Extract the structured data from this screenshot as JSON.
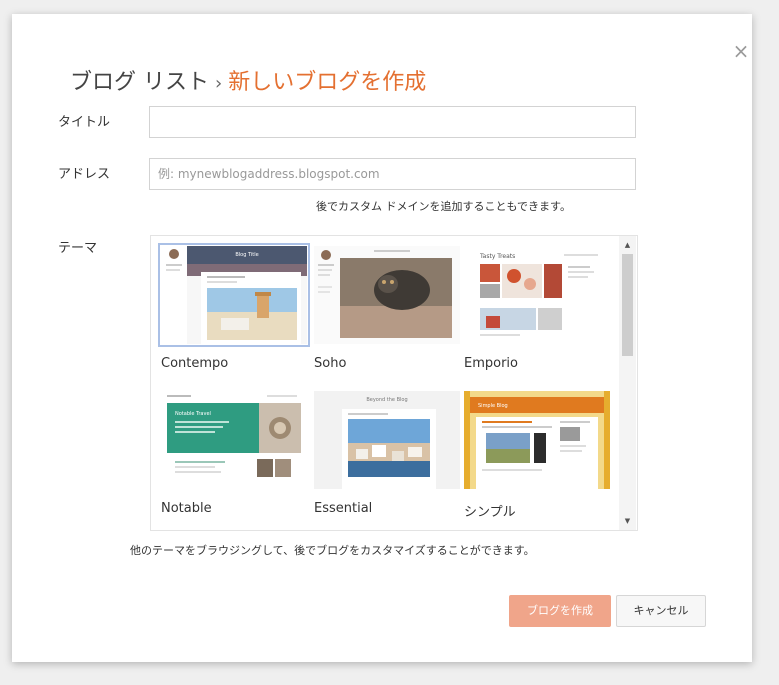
{
  "dialog": {
    "breadcrumb_parent": "ブログ リスト",
    "breadcrumb_separator": "›",
    "breadcrumb_current": "新しいブログを作成",
    "close_glyph": "×"
  },
  "form": {
    "title_label": "タイトル",
    "title_value": "",
    "address_label": "アドレス",
    "address_placeholder": "例: mynewblogaddress.blogspot.com",
    "address_hint": "後でカスタム ドメインを追加することもできます。",
    "theme_label": "テーマ"
  },
  "themes": [
    {
      "name": "Contempo",
      "selected": true
    },
    {
      "name": "Soho",
      "selected": false
    },
    {
      "name": "Emporio",
      "selected": false
    },
    {
      "name": "Notable",
      "selected": false
    },
    {
      "name": "Essential",
      "selected": false
    },
    {
      "name": "シンプル",
      "selected": false
    }
  ],
  "theme_thumb_text": {
    "contempo_header": "Blog Title",
    "emporio_header": "Tasty Treats",
    "notable_heading": "Notable Travel",
    "essential_header": "Beyond the Blog",
    "simple_header": "Simple Blog"
  },
  "theme_hint": "他のテーマをブラウジングして、後でブログをカスタマイズすることができます。",
  "buttons": {
    "create": "ブログを作成",
    "cancel": "キャンセル"
  },
  "colors": {
    "accent": "#e47031",
    "primary_button": "#f0a58a"
  }
}
